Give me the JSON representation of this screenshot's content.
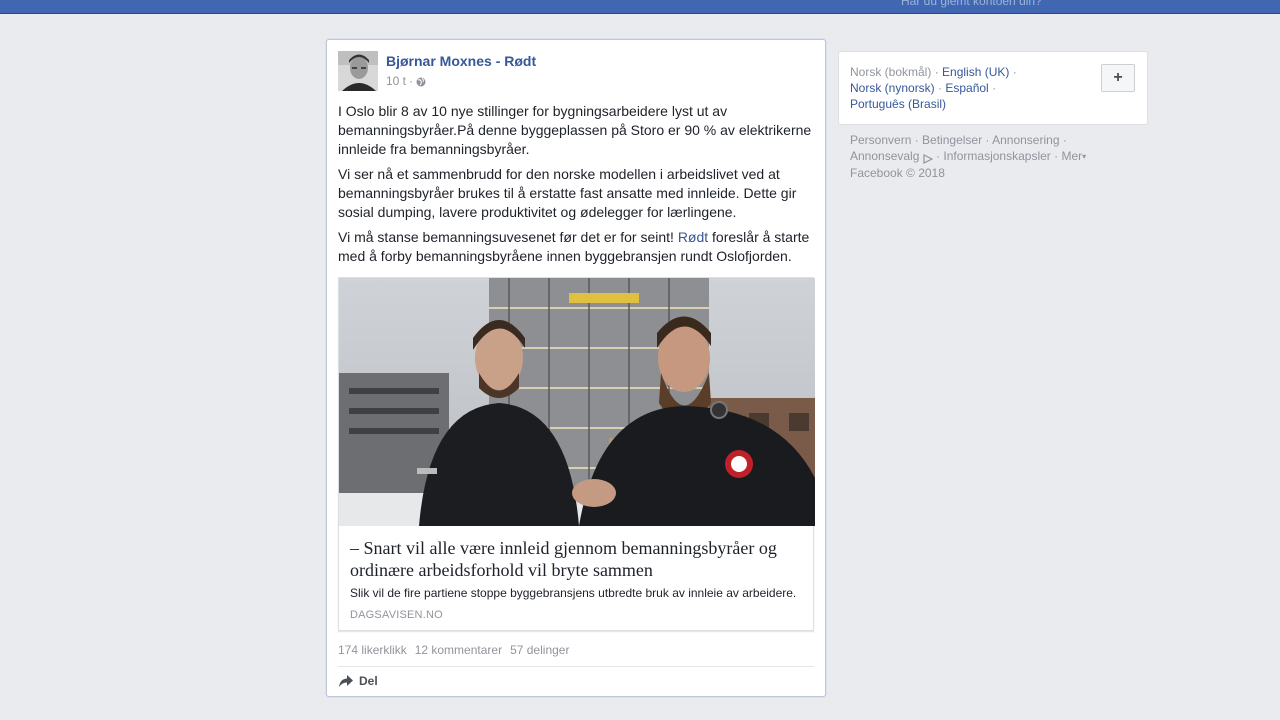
{
  "topbar": {
    "forgot_account": "Har du glemt kontoen din?"
  },
  "post": {
    "author": "Bjørnar Moxnes - Rødt",
    "time": "10 t",
    "paragraphs": [
      "I Oslo blir 8 av 10 nye stillinger for bygningsarbeidere lyst ut av bemanningsbyråer.På denne byggeplassen på Storo er 90 % av elektrikerne innleide fra bemanningsbyråer.",
      "Vi ser nå et sammenbrudd for den norske modellen i arbeidslivet ved at bemanningsbyråer brukes til å erstatte fast ansatte med innleide. Dette gir sosial dumping, lavere produktivitet og ødelegger for lærlingene."
    ],
    "p3_before": "Vi må stanse bemanningsuvesenet før det er for seint! ",
    "p3_link": "Rødt",
    "p3_after": " foreslår å starte med å forby bemanningsbyråene innen byggebransjen rundt Oslofjorden.",
    "link_card": {
      "headline": "– Snart vil alle være innleid gjennom bemanningsbyråer og ordinære arbeidsforhold vil bryte sammen",
      "description": "Slik vil de fire partiene stoppe byggebransjens utbredte bruk av innleie av arbeidere.",
      "source": "DAGSAVISEN.NO"
    },
    "stats": {
      "likes": "174 likerklikk",
      "comments": "12 kommentarer",
      "shares": "57 delinger"
    },
    "share_label": "Del"
  },
  "languages": {
    "current": "Norsk (bokmål)",
    "items": [
      "English (UK)",
      "Norsk (nynorsk)",
      "Español",
      "Português (Brasil)"
    ],
    "add_label": "+"
  },
  "footer": {
    "links": [
      "Personvern",
      "Betingelser",
      "Annonsering",
      "Annonsevalg",
      "Informasjonskapsler",
      "Mer"
    ],
    "copyright": "Facebook © 2018"
  },
  "colors": {
    "brand_blue": "#4267b2",
    "link": "#365899",
    "background": "#e9ebee"
  }
}
